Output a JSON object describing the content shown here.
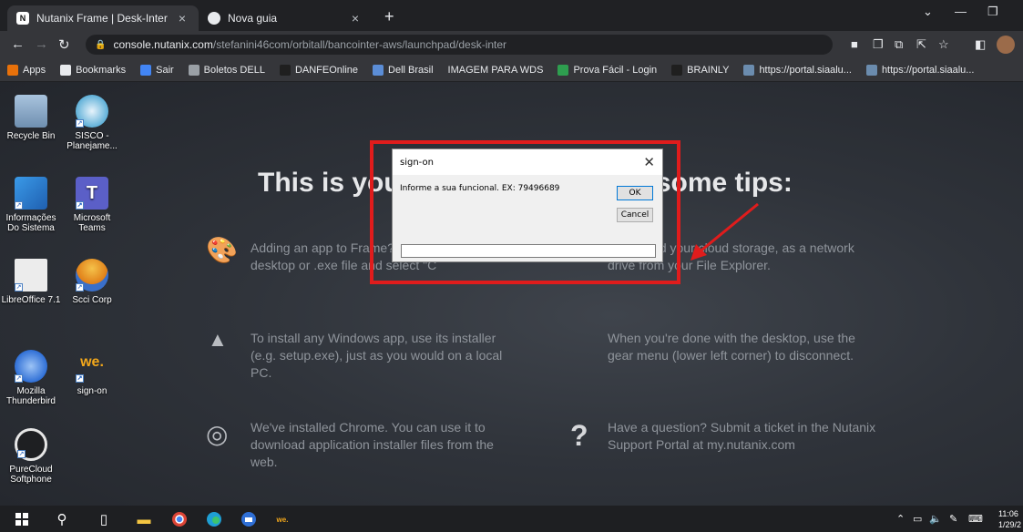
{
  "browser": {
    "tabs": [
      {
        "title": "Nutanix Frame | Desk-Inter",
        "favicon": "N"
      },
      {
        "title": "Nova guia"
      }
    ],
    "address": {
      "host": "console.nutanix.com",
      "path": "/stefanini46com/orbitall/bancointer-aws/launchpad/desk-inter"
    },
    "bookmarks": [
      {
        "label": "Apps",
        "icon": "apps-grid-icon",
        "color": "#e8710a"
      },
      {
        "label": "Bookmarks",
        "icon": "star-icon",
        "color": "#e8eaed"
      },
      {
        "label": "Sair",
        "icon": "google-icon",
        "color": "#4285f4"
      },
      {
        "label": "Boletos DELL",
        "icon": "chrome-icon",
        "color": "#9aa0a6"
      },
      {
        "label": "DANFEOnline",
        "icon": "d-icon",
        "color": "#1f1f1f"
      },
      {
        "label": "Dell Brasil",
        "icon": "dell-icon",
        "color": "#5b8dd6"
      },
      {
        "label": "IMAGEM PARA WDS",
        "icon": "",
        "color": ""
      },
      {
        "label": "Prova Fácil - Login",
        "icon": "lines-icon",
        "color": "#2e9e4f"
      },
      {
        "label": "BRAINLY",
        "icon": "brainly-icon",
        "color": "#1f1f1f"
      },
      {
        "label": "https://portal.siaalu...",
        "icon": "portal-icon",
        "color": "#6b8cae"
      },
      {
        "label": "https://portal.siaalu...",
        "icon": "portal-icon",
        "color": "#6b8cae"
      }
    ]
  },
  "desktop": {
    "icons": [
      {
        "label": "Recycle Bin",
        "icon": "recycle-bin-icon",
        "color": "#6f8fb0"
      },
      {
        "label": "SISCO - Planejame...",
        "icon": "sisco-icon",
        "color": "#5fb0d8"
      },
      {
        "label": "Informações Do Sistema",
        "icon": "system-info-icon",
        "color": "#2f7fd1"
      },
      {
        "label": "Microsoft Teams",
        "icon": "teams-icon",
        "color": "#5b5fc7"
      },
      {
        "label": "LibreOffice 7.1",
        "icon": "libreoffice-icon",
        "color": "#e9e9e9"
      },
      {
        "label": "Scci Corp",
        "icon": "scci-icon",
        "color": "#f0a020"
      },
      {
        "label": "Mozilla Thunderbird",
        "icon": "thunderbird-icon",
        "color": "#2f6fd6"
      },
      {
        "label": "sign-on",
        "icon": "we-logo-icon",
        "logo_text": "we.",
        "color": "#f2a71b"
      },
      {
        "label": "PureCloud Softphone",
        "icon": "headset-icon",
        "color": "#1e1f22"
      }
    ],
    "headline": "This is your desktop. Here are some tips:",
    "tips": [
      {
        "icon": "palette-icon",
        "text": "Adding an app to Frame? Just right click on its desktop or .exe file and select \"C"
      },
      {
        "icon": "cloud-icon",
        "text": "connected your cloud storage, as a network drive from your File Explorer."
      },
      {
        "icon": "installer-icon",
        "text": "To install any Windows app, use its installer (e.g. setup.exe), just as you would on a local PC."
      },
      {
        "icon": "gear-icon",
        "text": "When you're done with the desktop, use the gear menu (lower left corner) to disconnect."
      },
      {
        "icon": "chrome-icon",
        "text": "We've installed Chrome. You can use it to download application installer files from the web."
      },
      {
        "icon": "question-icon",
        "text": "Have a question? Submit a ticket in the Nutanix Support Portal at my.nutanix.com"
      }
    ]
  },
  "dialog": {
    "title": "sign-on",
    "message": "Informe a sua funcional. EX: 79496689",
    "ok_label": "OK",
    "cancel_label": "Cancel",
    "input_value": ""
  },
  "taskbar": {
    "time": "11:06",
    "date": "1/29/2"
  },
  "colors": {
    "highlight": "#e01c1c",
    "arrow": "#e01c1c"
  }
}
